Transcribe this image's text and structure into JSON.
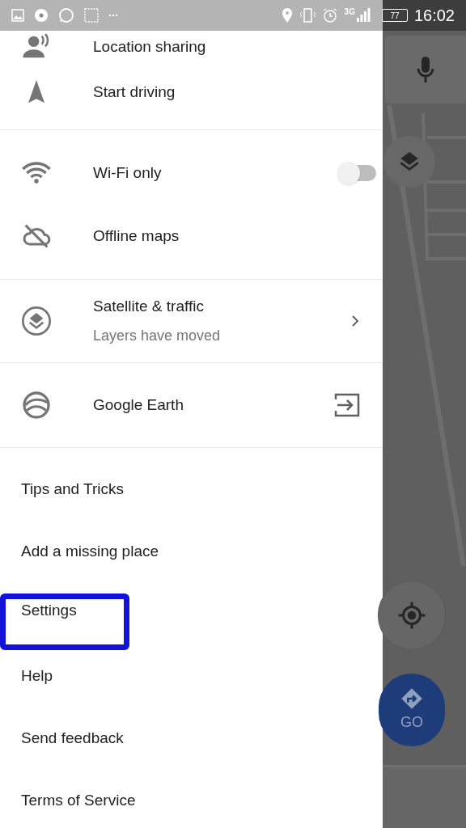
{
  "status_bar": {
    "network": "3G",
    "battery": "77",
    "time": "16:02"
  },
  "drawer": {
    "sections": [
      {
        "kind": "icon_rows",
        "items": [
          {
            "label": "Location sharing"
          },
          {
            "label": "Start driving"
          }
        ]
      },
      {
        "kind": "icon_rows",
        "items": [
          {
            "label": "Wi-Fi only",
            "kind": "toggle",
            "on": false
          },
          {
            "label": "Offline maps"
          }
        ]
      },
      {
        "kind": "icon_rows",
        "items": [
          {
            "label": "Satellite & traffic",
            "subtitle": "Layers have moved",
            "kind": "chevron"
          }
        ]
      },
      {
        "kind": "icon_rows",
        "items": [
          {
            "label": "Google Earth",
            "kind": "external"
          }
        ]
      },
      {
        "kind": "links",
        "items": [
          {
            "label": "Tips and Tricks",
            "annotated": false
          },
          {
            "label": "Add a missing place",
            "annotated": false
          },
          {
            "label": "Settings",
            "annotated": true
          },
          {
            "label": "Help",
            "annotated": false
          },
          {
            "label": "Send feedback",
            "annotated": false
          },
          {
            "label": "Terms of Service",
            "annotated": false
          }
        ]
      }
    ]
  },
  "map": {
    "go_label": "GO"
  }
}
